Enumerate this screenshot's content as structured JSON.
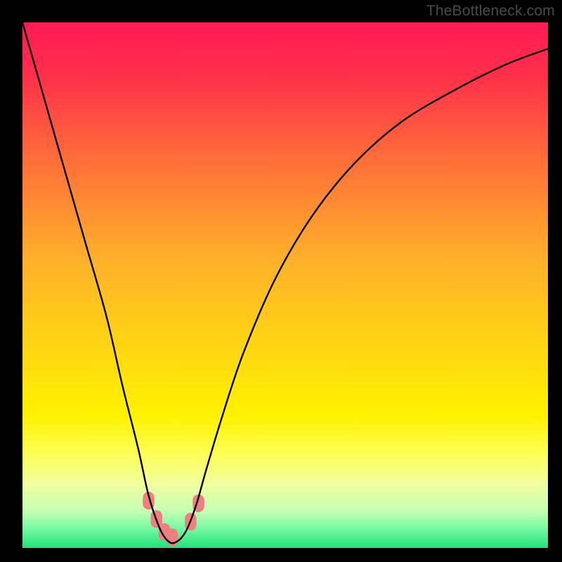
{
  "watermark": "TheBottleneck.com",
  "chart_data": {
    "type": "line",
    "title": "",
    "xlabel": "",
    "ylabel": "",
    "xlim": [
      0,
      100
    ],
    "ylim": [
      0,
      100
    ],
    "series": [
      {
        "name": "bottleneck-curve",
        "x": [
          0,
          4,
          8,
          12,
          16,
          19,
          22,
          24,
          26,
          27.5,
          29,
          31,
          33,
          35,
          38,
          42,
          48,
          55,
          63,
          72,
          82,
          92,
          100
        ],
        "y": [
          100,
          86,
          72,
          58,
          44,
          31,
          19,
          10,
          4,
          1.5,
          1,
          3,
          8,
          15,
          25,
          37,
          51,
          63,
          73,
          81,
          87,
          92,
          95
        ],
        "color": "#000000"
      }
    ],
    "background_gradient": {
      "stops": [
        {
          "offset": 0.0,
          "color": "#ff1a55"
        },
        {
          "offset": 0.1,
          "color": "#ff2f4a"
        },
        {
          "offset": 0.25,
          "color": "#ff6a3a"
        },
        {
          "offset": 0.45,
          "color": "#ffb02a"
        },
        {
          "offset": 0.62,
          "color": "#ffd612"
        },
        {
          "offset": 0.75,
          "color": "#fff200"
        },
        {
          "offset": 0.82,
          "color": "#fcff55"
        },
        {
          "offset": 0.88,
          "color": "#f0ffa0"
        },
        {
          "offset": 0.93,
          "color": "#c4ffb4"
        },
        {
          "offset": 0.965,
          "color": "#72f7a0"
        },
        {
          "offset": 1.0,
          "color": "#1de27a"
        }
      ]
    },
    "markers": [
      {
        "x": 24.0,
        "y": 9.0
      },
      {
        "x": 25.5,
        "y": 5.5
      },
      {
        "x": 27.0,
        "y": 3.0
      },
      {
        "x": 28.5,
        "y": 2.0
      },
      {
        "x": 32.0,
        "y": 5.0
      },
      {
        "x": 33.5,
        "y": 8.5
      }
    ],
    "marker_color": "#f08080",
    "marker_radius_px": 11
  }
}
